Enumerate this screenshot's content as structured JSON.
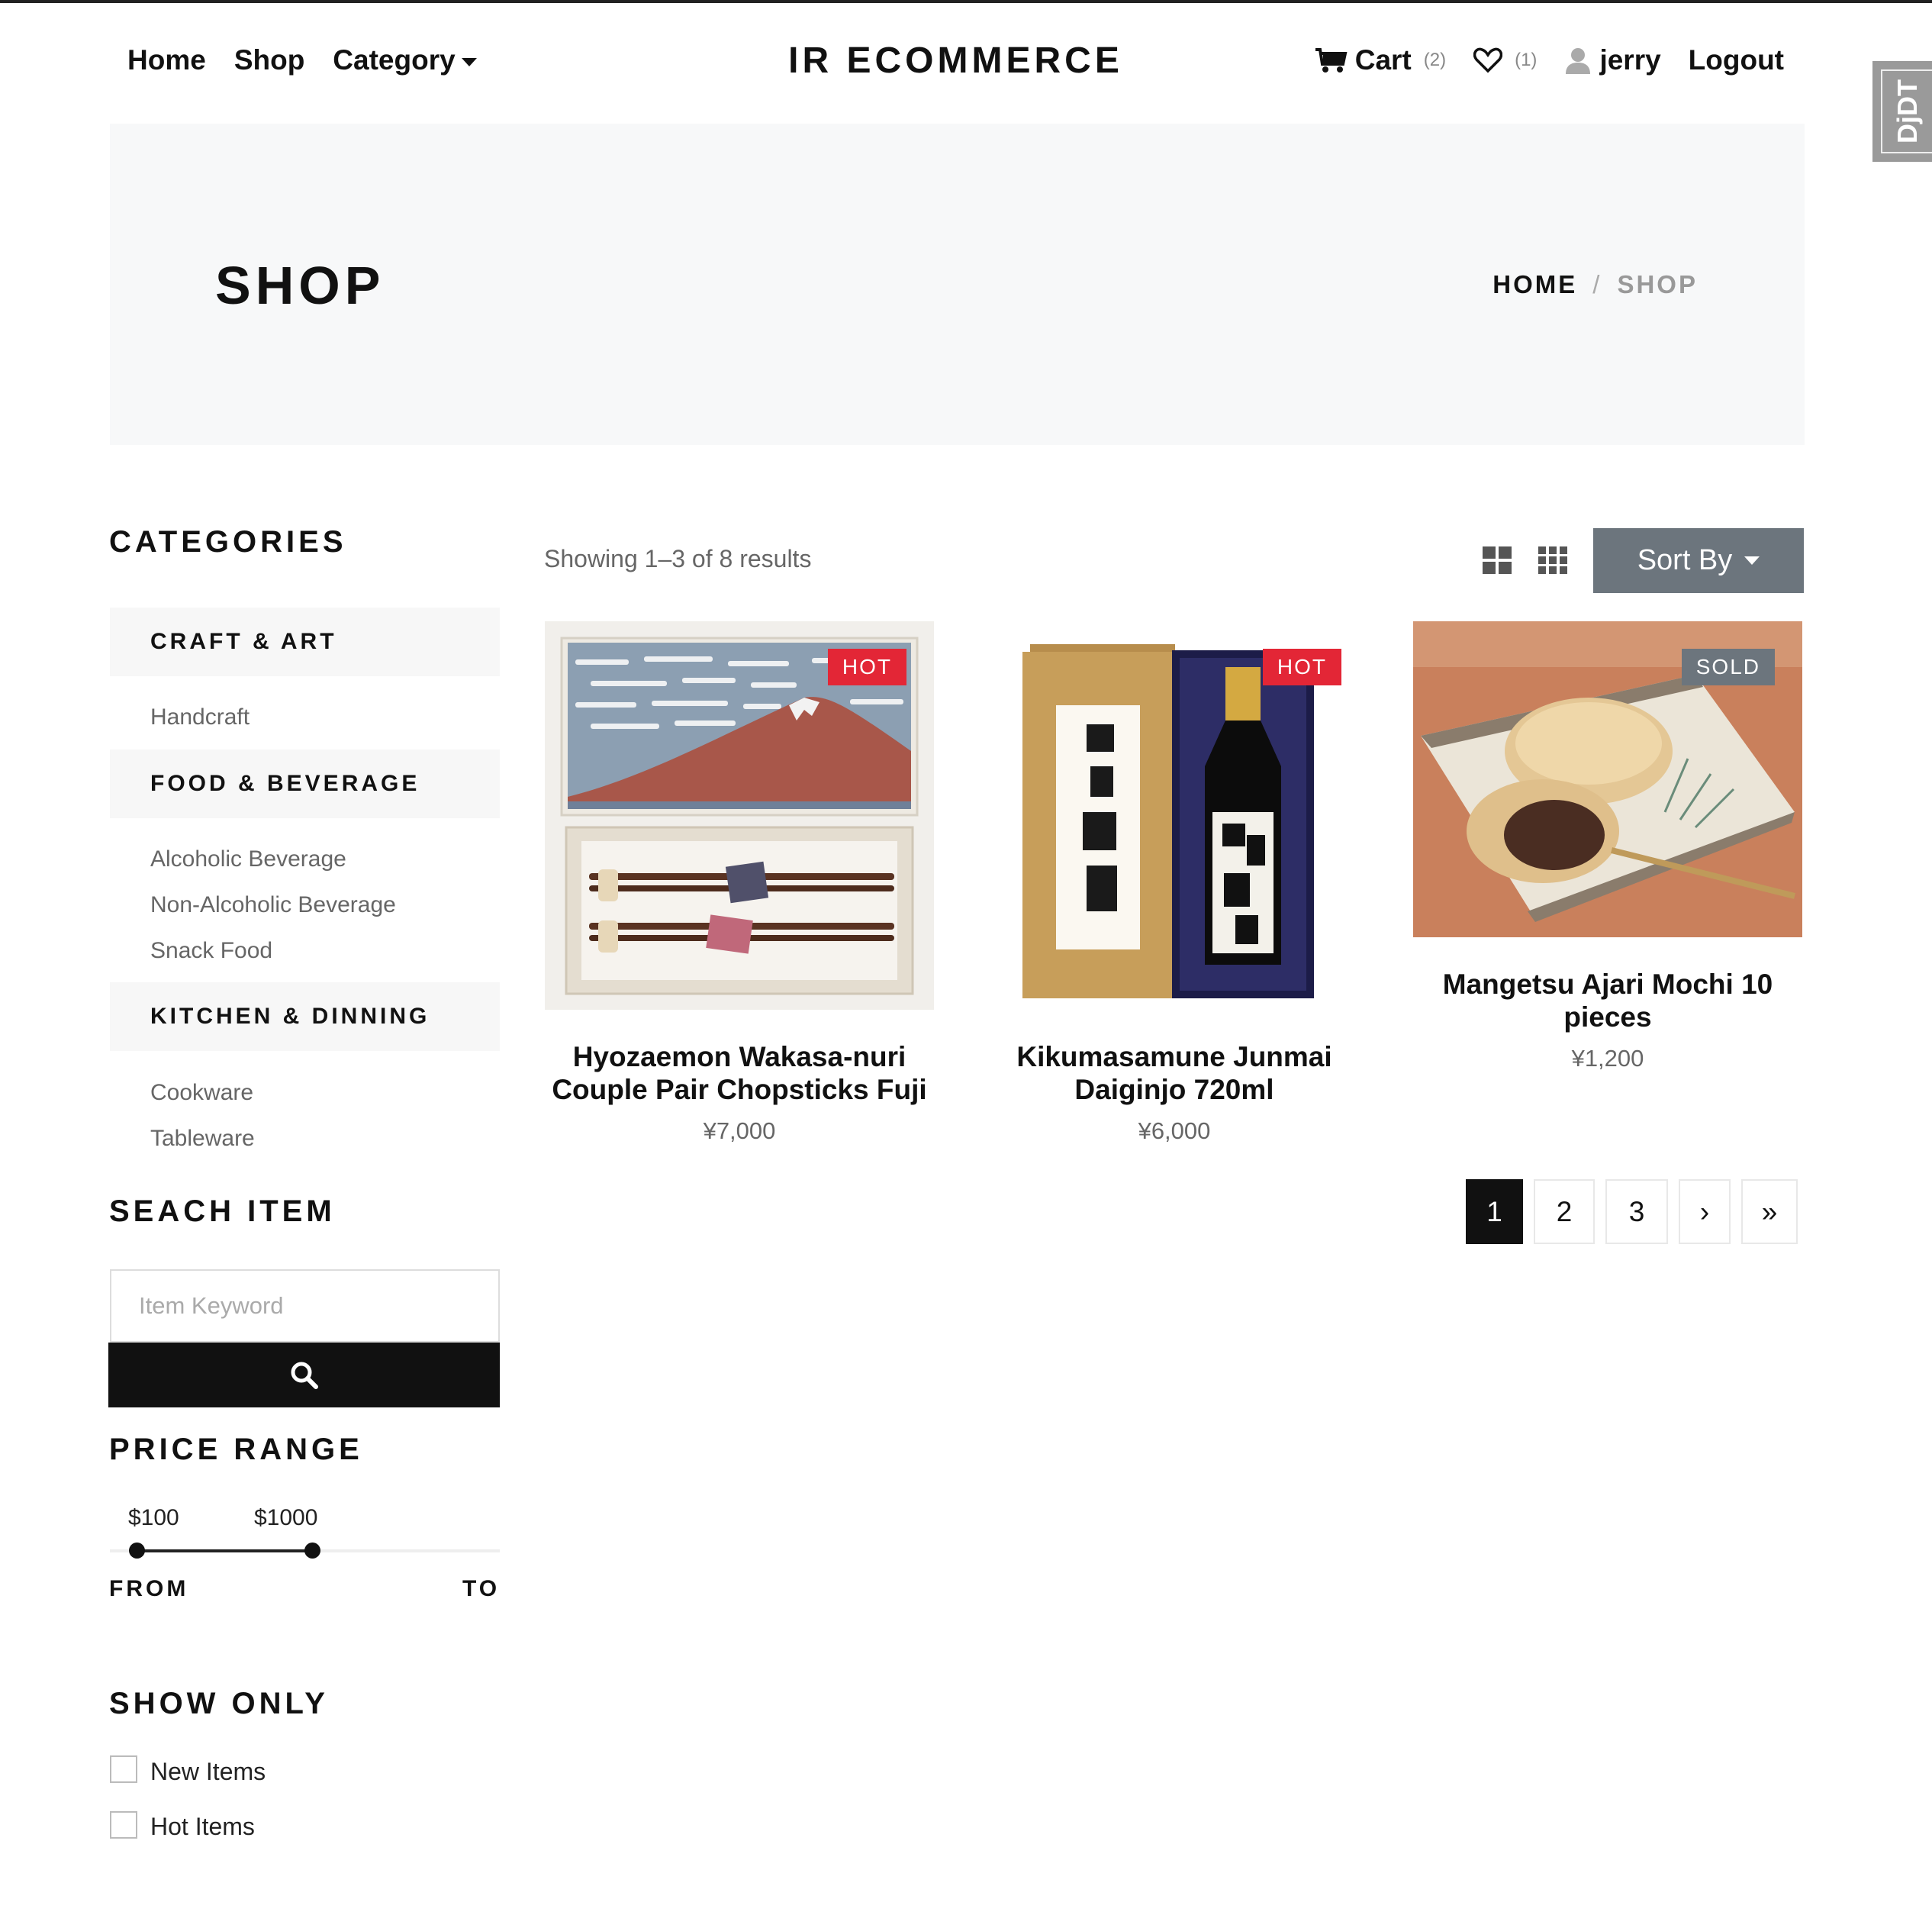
{
  "nav": {
    "home": "Home",
    "shop": "Shop",
    "category": "Category",
    "brand": "IR ECOMMERCE",
    "cart_label": "Cart",
    "cart_count": "(2)",
    "wishlist_count": "(1)",
    "user": "jerry",
    "logout": "Logout"
  },
  "djdt": "DjDT",
  "hero": {
    "title": "SHOP",
    "breadcrumb_home": "HOME",
    "breadcrumb_sep": "/",
    "breadcrumb_current": "SHOP"
  },
  "sidebar": {
    "categories_heading": "CATEGORIES",
    "groups": [
      {
        "label": "CRAFT & ART",
        "items": [
          "Handcraft"
        ]
      },
      {
        "label": "FOOD & BEVERAGE",
        "items": [
          "Alcoholic Beverage",
          "Non-Alcoholic Beverage",
          "Snack Food"
        ]
      },
      {
        "label": "KITCHEN & DINNING",
        "items": [
          "Cookware",
          "Tableware"
        ]
      }
    ],
    "search_heading": "SEACH ITEM",
    "search_placeholder": "Item Keyword",
    "price_heading": "PRICE RANGE",
    "price_min": "$100",
    "price_max": "$1000",
    "from_label": "FROM",
    "to_label": "TO",
    "show_only_heading": "SHOW ONLY",
    "filters": [
      "New Items",
      "Hot Items"
    ]
  },
  "main": {
    "results_text": "Showing 1–3 of 8 results",
    "sort_label": "Sort By",
    "products": [
      {
        "name": "Hyozaemon Wakasa-nuri Couple Pair Chopsticks Fuji",
        "price": "¥7,000",
        "badge": "HOT"
      },
      {
        "name": "Kikumasamune Junmai Daiginjo 720ml",
        "price": "¥6,000",
        "badge": "HOT"
      },
      {
        "name": "Mangetsu Ajari Mochi 10 pieces",
        "price": "¥1,200",
        "badge": "SOLD"
      }
    ],
    "pagination": [
      "1",
      "2",
      "3",
      "›",
      "»"
    ]
  },
  "colors": {
    "hot_badge": "#e32636",
    "sold_badge": "#6c757d",
    "sort_button": "#6c757d",
    "hero_bg": "#f7f8f9"
  }
}
